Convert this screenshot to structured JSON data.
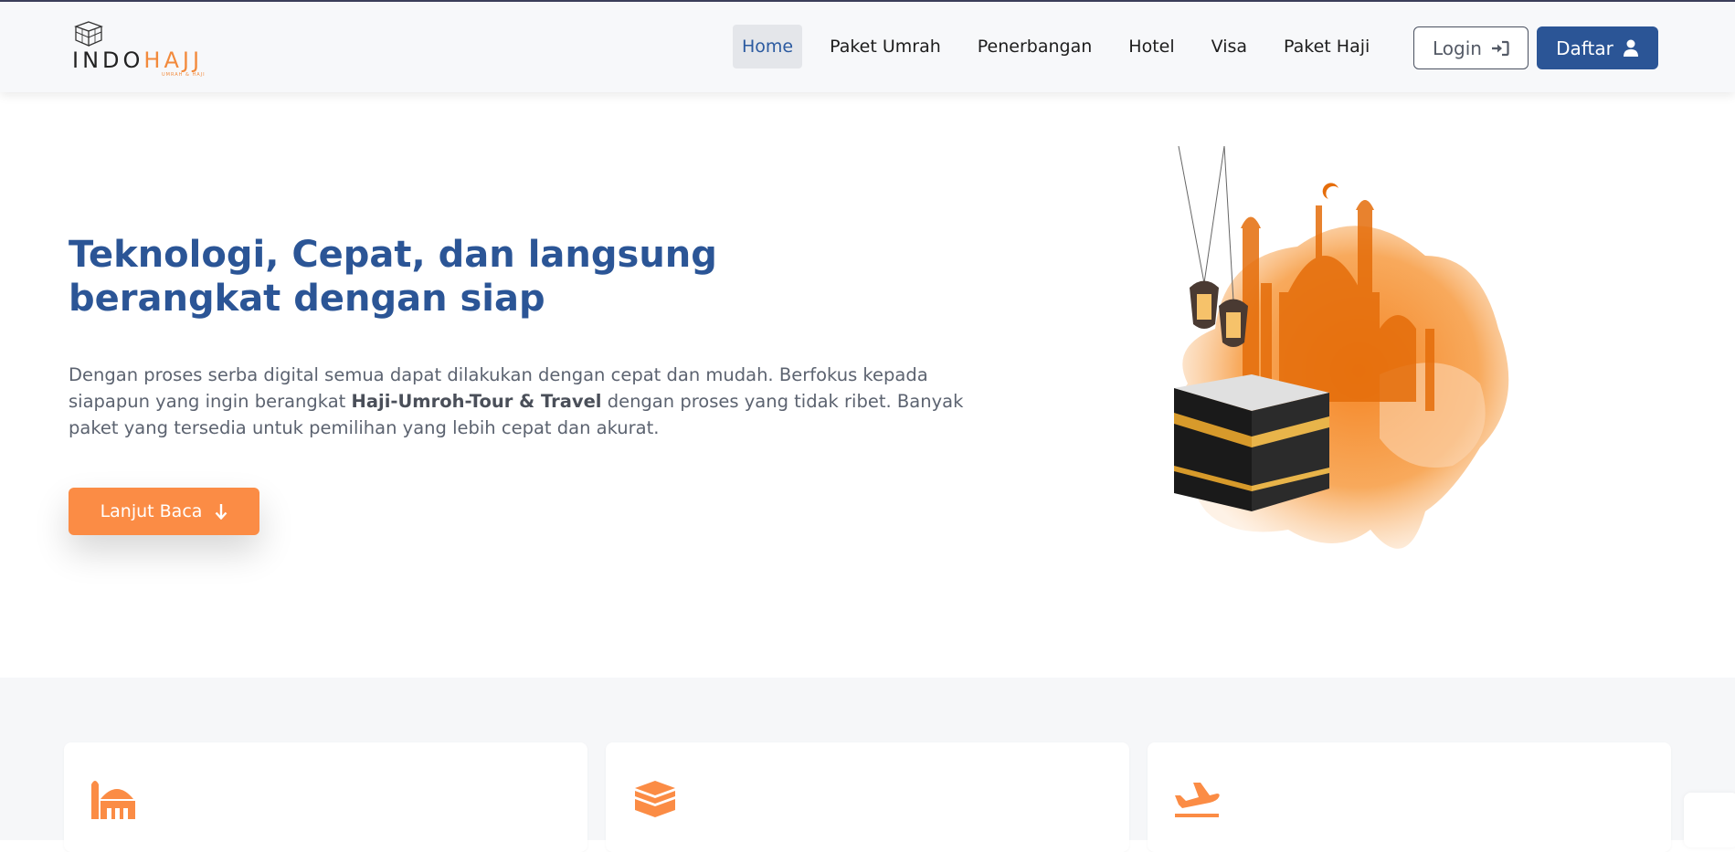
{
  "brand": {
    "name_part1": "INDO",
    "name_part2": "HAJJ",
    "tagline": "UMRAH & HAJI"
  },
  "nav": {
    "items": [
      {
        "label": "Home",
        "active": true
      },
      {
        "label": "Paket Umrah",
        "active": false
      },
      {
        "label": "Penerbangan",
        "active": false
      },
      {
        "label": "Hotel",
        "active": false
      },
      {
        "label": "Visa",
        "active": false
      },
      {
        "label": "Paket Haji",
        "active": false
      }
    ],
    "login_label": "Login",
    "daftar_label": "Daftar"
  },
  "hero": {
    "title": "Teknologi, Cepat, dan langsung berangkat dengan siap",
    "text_before": "Dengan proses serba digital semua dapat dilakukan dengan cepat dan mudah. Berfokus kepada siapapun yang ingin berangkat ",
    "text_bold": "Haji-Umroh-Tour & Travel",
    "text_after": " dengan proses yang tidak ribet. Banyak paket yang tersedia untuk pemilihan yang lebih cepat dan akurat.",
    "button_label": "Lanjut Baca"
  },
  "services": [
    {
      "icon": "mosque-icon"
    },
    {
      "icon": "kaaba-icon"
    },
    {
      "icon": "plane-departure-icon"
    }
  ],
  "colors": {
    "primary": "#2b5596",
    "accent": "#fb8c45",
    "nav_active_bg": "#e4e6ea"
  }
}
